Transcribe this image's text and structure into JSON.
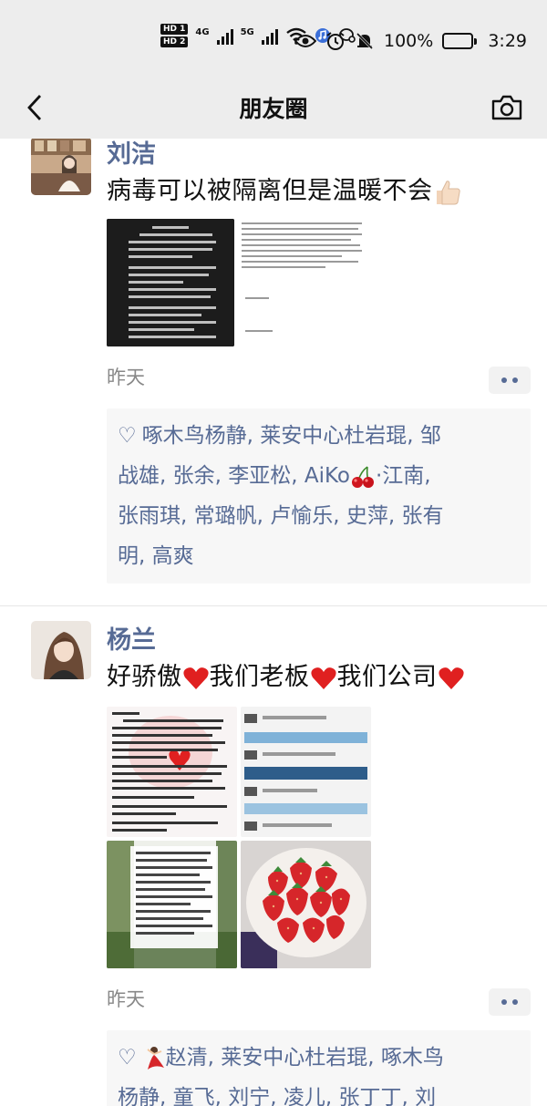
{
  "status_bar": {
    "hd1": "HD 1",
    "hd2": "HD 2",
    "net1": "4G",
    "net2": "5G",
    "battery_percent": "100%",
    "time": "3:29",
    "battery_level": 1.0
  },
  "nav": {
    "title": "朋友圈"
  },
  "posts": [
    {
      "name": "刘洁",
      "text": "病毒可以被隔离但是温暖不会",
      "time": "昨天",
      "likes_line1": "啄木鸟杨静, 莱安中心杜岩琨, 邹",
      "likes_line2": "战雄, 张余, 李亚松, AiKo",
      "likes_line2b": "·江南,",
      "likes_line3": "张雨琪, 常璐帆, 卢愉乐, 史萍, 张有",
      "likes_line4": "明, 高爽"
    },
    {
      "name": "杨兰",
      "text": "好骄傲",
      "text2": "我们老板",
      "text3": "我们公司",
      "time": "昨天",
      "likes_line1": "赵清, 莱安中心杜岩琨, 啄木鸟",
      "likes_line2": "杨静, 童飞, 刘宁, 凌儿, 张丁丁, 刘"
    }
  ],
  "colors": {
    "link": "#576b95",
    "bar": "#ededed",
    "heart_emoji": "#e02020"
  }
}
